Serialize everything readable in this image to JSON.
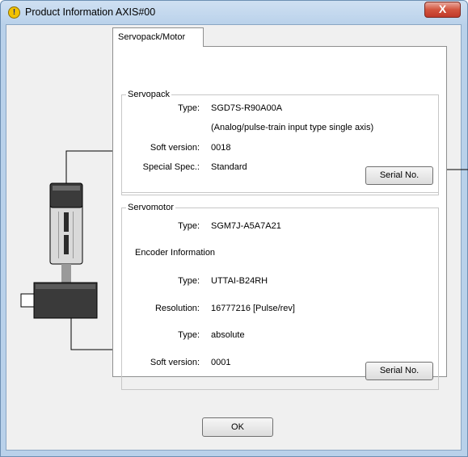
{
  "window": {
    "title": "Product Information AXIS#00",
    "close_label": "X"
  },
  "tabs": [
    {
      "label": "Servopack/Motor"
    }
  ],
  "servopack": {
    "legend": "Servopack",
    "type_label": "Type:",
    "type_value": "SGD7S-R90A00A",
    "type_desc": "(Analog/pulse-train input type single axis)",
    "soft_version_label": "Soft version:",
    "soft_version_value": "0018",
    "special_spec_label": "Special Spec.:",
    "special_spec_value": "Standard",
    "serial_button": "Serial No."
  },
  "servomotor": {
    "legend": "Servomotor",
    "type_label": "Type:",
    "type_value": "SGM7J-A5A7A21",
    "encoder_info_label": "Encoder Information",
    "encoder_type_label": "Type:",
    "encoder_type_value": "UTTAI-B24RH",
    "resolution_label": "Resolution:",
    "resolution_value": "16777216 [Pulse/rev]",
    "abs_type_label": "Type:",
    "abs_type_value": "absolute",
    "soft_version_label": "Soft version:",
    "soft_version_value": "0001",
    "serial_button": "Serial No."
  },
  "footer": {
    "ok_label": "OK"
  },
  "icons": {
    "title_icon": "info-icon",
    "close_icon": "close-icon"
  },
  "colors": {
    "titlebar": "#b9d1ea",
    "close": "#c0392b",
    "dialog_bg": "#f0f0f0"
  }
}
